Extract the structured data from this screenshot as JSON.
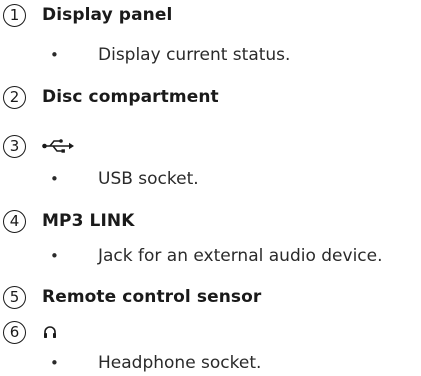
{
  "items": [
    {
      "number": "1",
      "title": "Display panel",
      "description": "Display current status."
    },
    {
      "number": "2",
      "title": "Disc compartment"
    },
    {
      "number": "3",
      "icon": "usb-icon",
      "description": "USB socket."
    },
    {
      "number": "4",
      "title": "MP3 LINK",
      "description": "Jack for an external audio device."
    },
    {
      "number": "5",
      "title": "Remote control sensor"
    },
    {
      "number": "6",
      "icon": "headphone-icon",
      "description": "Headphone socket."
    }
  ],
  "bullet_char": "•"
}
